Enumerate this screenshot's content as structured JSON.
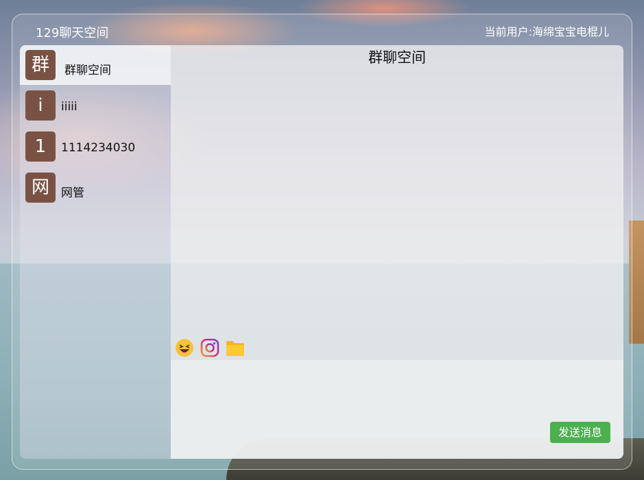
{
  "header": {
    "app_title": "129聊天空间",
    "current_user": "当前用户:海绵宝宝电棍儿"
  },
  "contacts": [
    {
      "avatar": "群",
      "name": "群聊空间",
      "active": true
    },
    {
      "avatar": "i",
      "name": "iiiii",
      "active": false
    },
    {
      "avatar": "1",
      "name": "1114234030",
      "active": false
    },
    {
      "avatar": "网",
      "name": "网管",
      "active": false
    }
  ],
  "chat": {
    "title": "群聊空间",
    "tools": [
      "emoji-icon",
      "instagram-icon",
      "folder-icon"
    ],
    "input_value": "",
    "send_label": "发送消息"
  },
  "colors": {
    "avatar_bg": "#7a5244",
    "send_button": "#4caf50"
  }
}
